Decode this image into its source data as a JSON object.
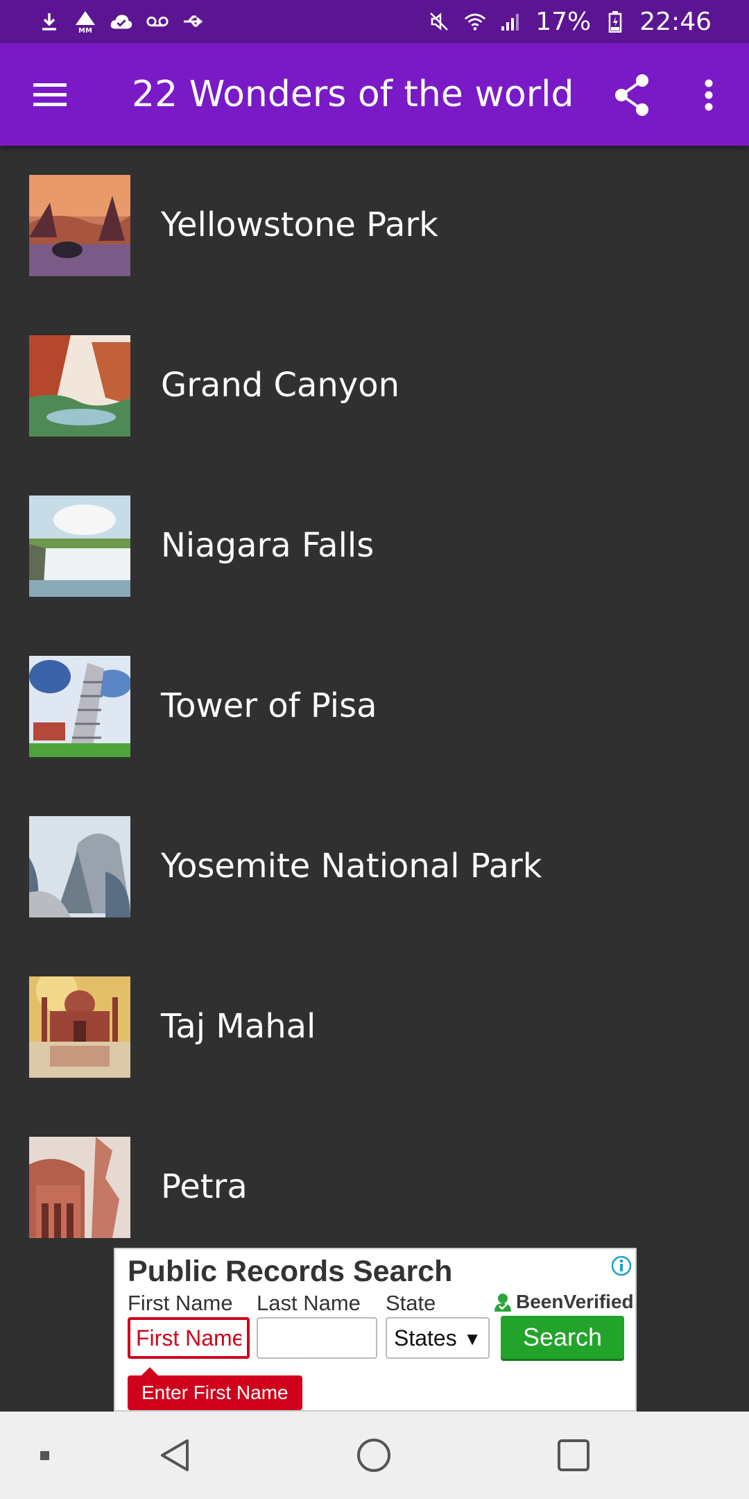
{
  "status_bar": {
    "left_icons": [
      "download-icon",
      "mm-alert-icon",
      "cloud-check-icon",
      "voicemail-icon",
      "usb-icon"
    ],
    "right_icons": [
      "mute-icon",
      "wifi-icon",
      "signal-icon"
    ],
    "battery": "17%",
    "time": "22:46"
  },
  "app_bar": {
    "title": "22 Wonders of the world",
    "menu_icon": "hamburger-menu-icon",
    "share_icon": "share-icon",
    "more_icon": "more-vert-icon"
  },
  "wonders": [
    {
      "name": "Yellowstone Park",
      "thumb": "yellowstone-thumbnail"
    },
    {
      "name": "Grand Canyon",
      "thumb": "grand-canyon-thumbnail"
    },
    {
      "name": "Niagara Falls",
      "thumb": "niagara-falls-thumbnail"
    },
    {
      "name": "Tower of Pisa",
      "thumb": "tower-of-pisa-thumbnail"
    },
    {
      "name": "Yosemite National Park",
      "thumb": "yosemite-thumbnail"
    },
    {
      "name": "Taj Mahal",
      "thumb": "taj-mahal-thumbnail"
    },
    {
      "name": "Petra",
      "thumb": "petra-thumbnail"
    }
  ],
  "ad": {
    "title": "Public Records Search",
    "brand": "BeenVerified",
    "first_name_label": "First Name",
    "last_name_label": "Last Name",
    "state_label": "State",
    "first_name_placeholder": "First Name",
    "last_name_value": "",
    "state_value": "States",
    "search_label": "Search",
    "error_tooltip": "Enter First Name"
  },
  "colors": {
    "status_bar": "#5c1592",
    "app_bar": "#7a1ac6",
    "background": "#303030",
    "ad_error": "#d0021b",
    "ad_button": "#22a32a",
    "nav_bar": "#efefef"
  },
  "nav_bar": {
    "icons": [
      "nav-dot-icon",
      "back-icon",
      "home-icon",
      "recents-icon"
    ]
  }
}
